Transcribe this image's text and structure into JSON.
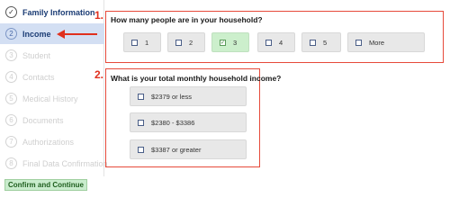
{
  "steps": [
    {
      "number": "✓",
      "label": "Family Information",
      "state": "done"
    },
    {
      "number": "2",
      "label": "Income",
      "state": "active"
    },
    {
      "number": "3",
      "label": "Student",
      "state": "pending"
    },
    {
      "number": "4",
      "label": "Contacts",
      "state": "pending"
    },
    {
      "number": "5",
      "label": "Medical History",
      "state": "pending"
    },
    {
      "number": "6",
      "label": "Documents",
      "state": "pending"
    },
    {
      "number": "7",
      "label": "Authorizations",
      "state": "pending"
    },
    {
      "number": "8",
      "label": "Final Data Confirmation",
      "state": "pending"
    }
  ],
  "annotations": {
    "one": "1.",
    "two": "2."
  },
  "question1": {
    "title": "How many people are in your household?",
    "options": [
      {
        "label": "1",
        "selected": false
      },
      {
        "label": "2",
        "selected": false
      },
      {
        "label": "3",
        "selected": true
      },
      {
        "label": "4",
        "selected": false
      },
      {
        "label": "5",
        "selected": false
      },
      {
        "label": "More",
        "selected": false
      }
    ]
  },
  "question2": {
    "title": "What is your total monthly household income?",
    "options": [
      {
        "label": "$2379 or less",
        "selected": false
      },
      {
        "label": "$2380 - $3386",
        "selected": false
      },
      {
        "label": "$3387 or greater",
        "selected": false
      }
    ]
  },
  "confirm_label": "Confirm and Continue",
  "colors": {
    "annotation": "#e0301e",
    "active_step_bg": "#d3dff3",
    "selected_option_bg": "#ccefcc",
    "confirm_bg": "#c9eccd"
  }
}
